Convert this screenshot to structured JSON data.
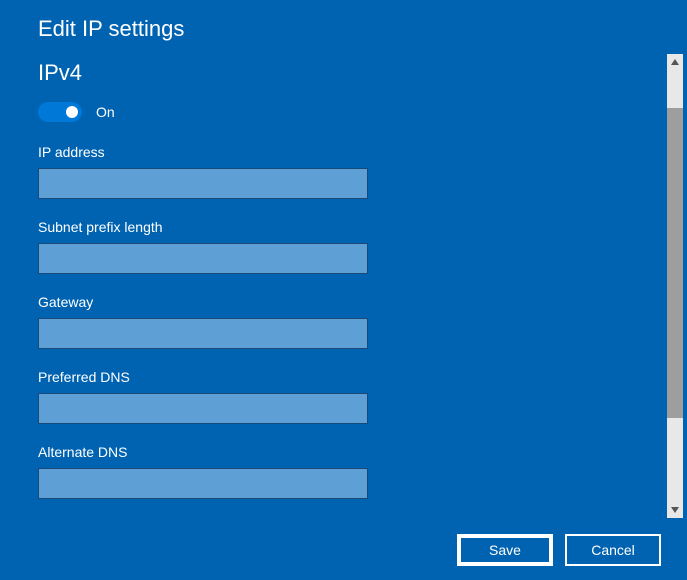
{
  "dialog": {
    "title": "Edit IP settings",
    "section": "IPv4",
    "toggle": {
      "state": "On",
      "label": "On"
    },
    "fields": {
      "ip_address": {
        "label": "IP address",
        "value": ""
      },
      "subnet_prefix": {
        "label": "Subnet prefix length",
        "value": ""
      },
      "gateway": {
        "label": "Gateway",
        "value": ""
      },
      "preferred_dns": {
        "label": "Preferred DNS",
        "value": ""
      },
      "alternate_dns": {
        "label": "Alternate DNS",
        "value": ""
      }
    },
    "buttons": {
      "save": "Save",
      "cancel": "Cancel"
    }
  }
}
